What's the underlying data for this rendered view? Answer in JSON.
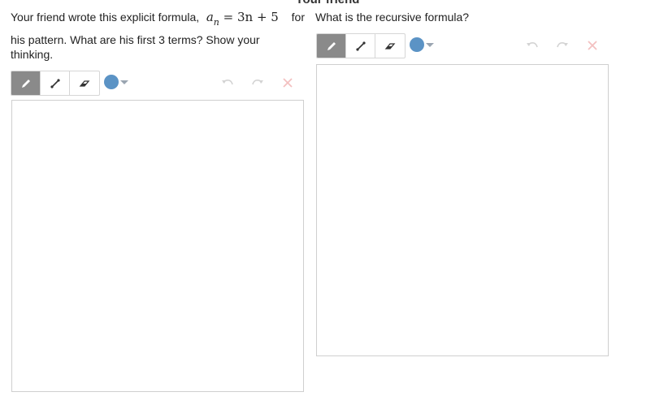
{
  "header": {
    "title": "Your friend"
  },
  "left_panel": {
    "prompt_start": "Your friend wrote this explicit formula,",
    "formula": {
      "a": "a",
      "sub": "n",
      "rhs": "= 3n + 5"
    },
    "prompt_for": "for",
    "prompt_rest": "his pattern. What are his first 3 terms? Show your thinking."
  },
  "right_panel": {
    "prompt": "What is the recursive formula?"
  },
  "toolbar": {
    "tools": [
      "pencil",
      "line",
      "eraser"
    ],
    "active_tool": "pencil",
    "color": "#5b93c5",
    "actions": [
      "undo",
      "redo",
      "clear"
    ]
  },
  "colors": {
    "active_tool_bg": "#8a8a8a",
    "undo_redo_disabled": "#d3d3d3",
    "clear_disabled": "#f3c0c0",
    "canvas_border": "#cfcfcf"
  }
}
